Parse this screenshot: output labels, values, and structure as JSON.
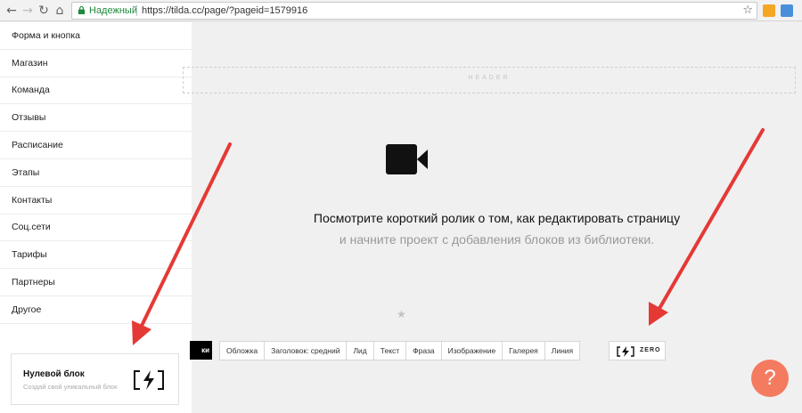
{
  "browser": {
    "back_icon": "back-arrow-icon",
    "forward_icon": "forward-arrow-icon",
    "reload_icon": "reload-icon",
    "home_icon": "home-icon",
    "secure_label": "Надежный",
    "url": "https://tilda.cc/page/?pageid=1579916",
    "bookmark_icon": "star-icon"
  },
  "sidebar": {
    "items": [
      {
        "label": "Форма и кнопка"
      },
      {
        "label": "Магазин"
      },
      {
        "label": "Команда"
      },
      {
        "label": "Отзывы"
      },
      {
        "label": "Расписание"
      },
      {
        "label": "Этапы"
      },
      {
        "label": "Контакты"
      },
      {
        "label": "Соц.сети"
      },
      {
        "label": "Тарифы"
      },
      {
        "label": "Партнеры"
      },
      {
        "label": "Другое"
      }
    ],
    "zero_block": {
      "title": "Нулевой блок",
      "subtitle": "Создай свой уникальный блок"
    }
  },
  "main": {
    "header_label": "HEADER",
    "line1": "Посмотрите короткий ролик о том, как редактировать страницу",
    "line2": "и начните проект с добавления блоков из библиотеки.",
    "black_button_label": "ки",
    "categories": [
      "Обложка",
      "Заголовок: средний",
      "Лид",
      "Текст",
      "Фраза",
      "Изображение",
      "Галерея",
      "Линия"
    ],
    "zero_label": "ZERO",
    "help_label": "?"
  },
  "colors": {
    "accent_arrow": "#e53935",
    "help_button": "#f47b60",
    "secure_text": "#1e8a3c"
  }
}
